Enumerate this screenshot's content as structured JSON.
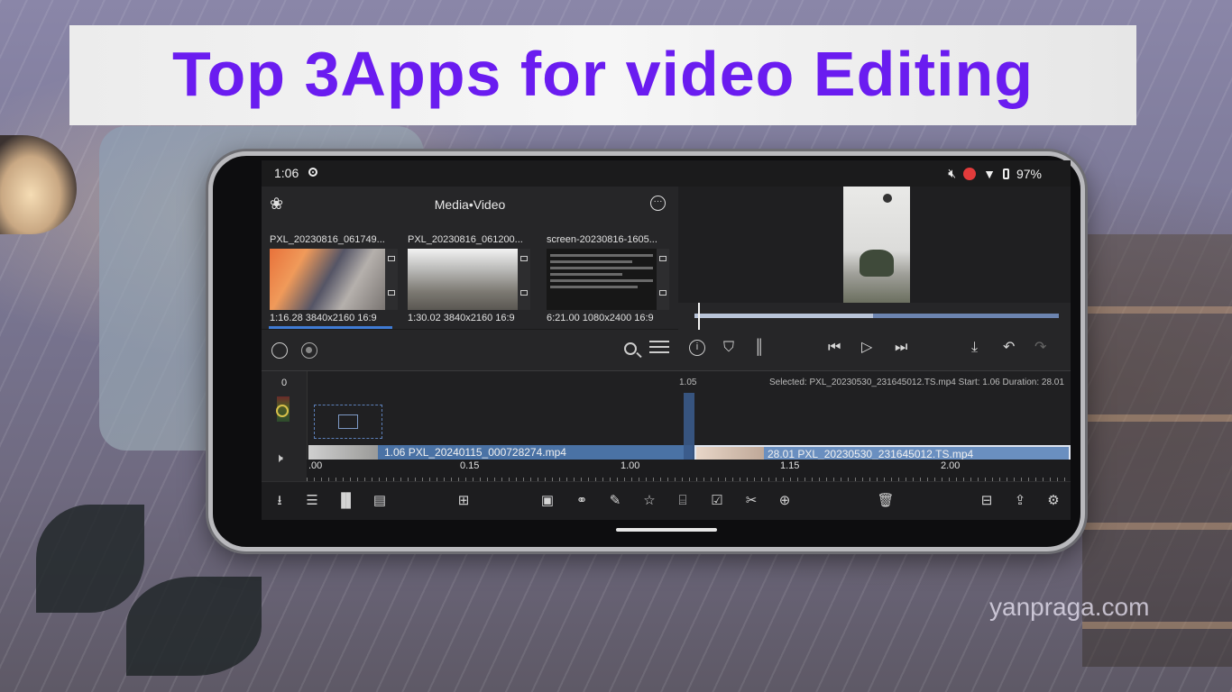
{
  "banner": {
    "title": "Top 3Apps for video Editing"
  },
  "status_bar": {
    "time": "1:06",
    "battery": "97%"
  },
  "media_panel": {
    "title": "Media•Video",
    "clips": [
      {
        "name": "PXL_20230816_061749...",
        "info": "1:16.28 3840x2160 16:9"
      },
      {
        "name": "PXL_20230816_061200...",
        "info": "1:30.02 3840x2160 16:9"
      },
      {
        "name": "screen-20230816-1605...",
        "info": "6:21.00 1080x2400 16:9"
      }
    ]
  },
  "timeline": {
    "level_zero": "0",
    "playhead_time": "1.05",
    "selected_info": "Selected: PXL_20230530_231645012.TS.mp4 Start: 1.06 Duration: 28.01",
    "clip1_label": "1.06 PXL_20240115_000728274.mp4",
    "clip2_label": "28.01 PXL_20230530_231645012.TS.mp4",
    "ruler_labels": [
      ".00",
      "0.15",
      "1.00",
      "1.15",
      "2.00"
    ]
  },
  "watermark": "yanpraga.com",
  "colors": {
    "banner_text": "#6a1cf0",
    "accent_blue": "#3f7bd4",
    "clip_blue": "#4a72a5"
  }
}
